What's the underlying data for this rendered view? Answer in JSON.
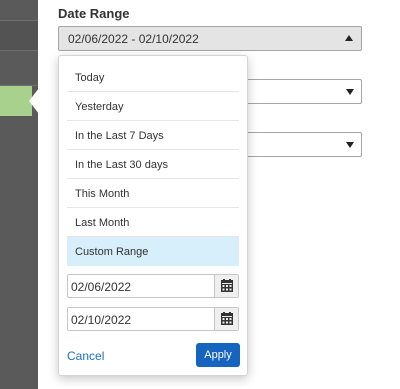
{
  "date_range": {
    "label": "Date Range",
    "selected_value": "02/06/2022 - 02/10/2022"
  },
  "dropdown": {
    "options": [
      "Today",
      "Yesterday",
      "In the Last 7 Days",
      "In the Last 30 days",
      "This Month",
      "Last Month",
      "Custom Range"
    ],
    "selected_option": "Custom Range",
    "start_date": "02/06/2022",
    "end_date": "02/10/2022",
    "cancel_label": "Cancel",
    "apply_label": "Apply"
  },
  "icons": {
    "calendar": "calendar-icon",
    "caret_up": "caret-up-icon",
    "caret_down": "caret-down-icon"
  },
  "colors": {
    "sidebar": "#5a5a5a",
    "sidebar_active": "#a9d18e",
    "selected_option_bg": "#d7eefb",
    "apply_bg": "#1565c0",
    "link": "#1f6fc5"
  }
}
